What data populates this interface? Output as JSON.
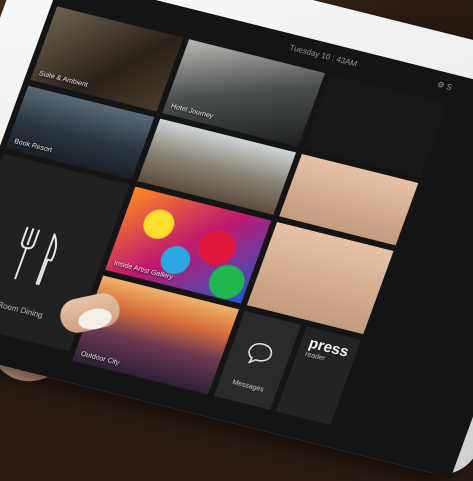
{
  "status_bar": {
    "time": "Tuesday 10 : 43AM",
    "settings": "⚙ S"
  },
  "tiles": {
    "tile_1": {
      "label": "Suite & Ambient"
    },
    "tile_2": {
      "label": "Hotel Journey"
    },
    "tile_3": {
      "label": "Book Resort"
    },
    "tile_4": {
      "label": ""
    },
    "room_dining": {
      "label": "In Room Dining",
      "icon": "fork-knife-icon"
    },
    "art_tile": {
      "label": "Inside Artist Gallery"
    },
    "outdoor_tile": {
      "label": "Outdoor City"
    },
    "messages_tile": {
      "label": "Messages",
      "icon": "speech-bubble-icon"
    },
    "press_tile": {
      "label": "press",
      "sub": "reader"
    }
  }
}
